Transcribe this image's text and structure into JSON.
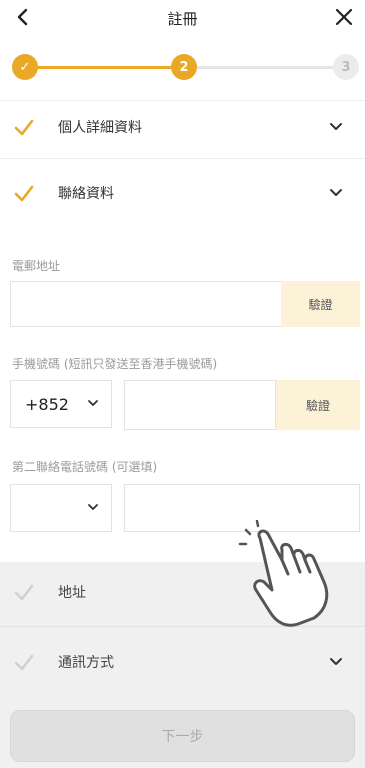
{
  "header": {
    "title": "註冊",
    "back_icon": "chevron-left-icon",
    "close_icon": "close-icon"
  },
  "stepper": {
    "steps": [
      {
        "label": "✓",
        "state": "done"
      },
      {
        "label": "2",
        "state": "active"
      },
      {
        "label": "3",
        "state": "todo"
      }
    ]
  },
  "sections": {
    "personal": {
      "label": "個人詳細資料",
      "status": "done"
    },
    "contact": {
      "label": "聯絡資料",
      "status": "done"
    },
    "address": {
      "label": "地址"
    },
    "communication": {
      "label": "通訊方式"
    }
  },
  "form": {
    "email": {
      "label": "電郵地址",
      "value": "",
      "verify_label": "驗證"
    },
    "mobile": {
      "label": "手機號碼 (短訊只發送至香港手機號碼)",
      "country_code": "+852",
      "value": "",
      "verify_label": "驗證"
    },
    "second_phone": {
      "label": "第二聯絡電話號碼 (可選填)",
      "country_code": "",
      "value": ""
    }
  },
  "footer": {
    "next_label": "下一步"
  },
  "colors": {
    "accent": "#e9a825",
    "verify_bg": "#fbf2d8",
    "disabled_bg": "#e0e0e0"
  }
}
